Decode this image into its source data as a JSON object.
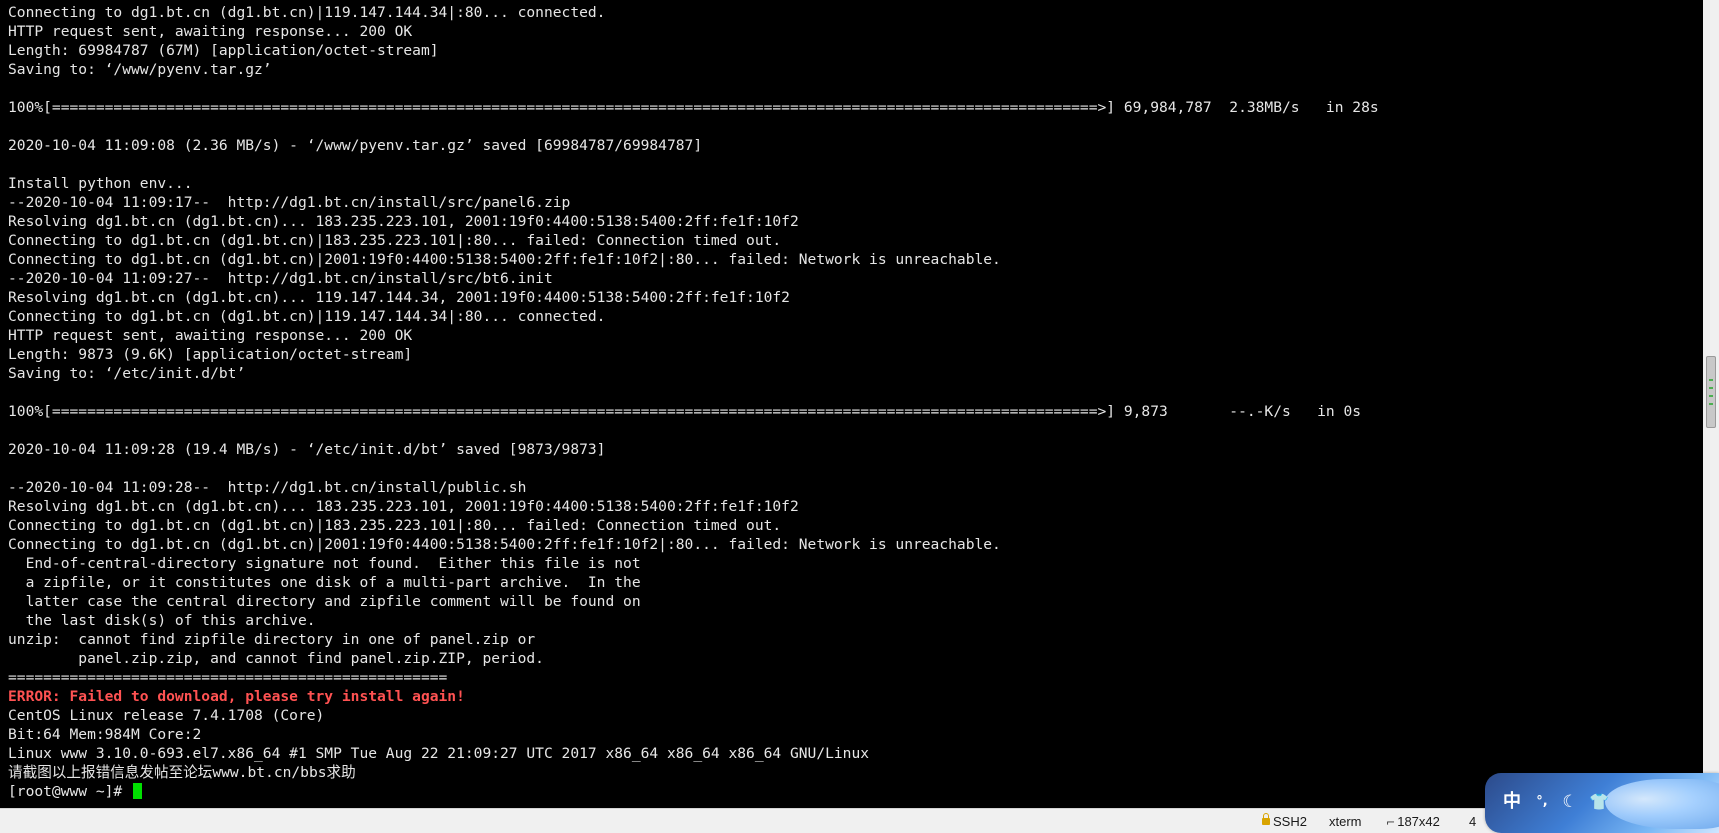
{
  "terminal": {
    "lines": [
      {
        "text": "Connecting to dg1.bt.cn (dg1.bt.cn)|119.147.144.34|:80... connected.",
        "kind": "normal"
      },
      {
        "text": "HTTP request sent, awaiting response... 200 OK",
        "kind": "normal"
      },
      {
        "text": "Length: 69984787 (67M) [application/octet-stream]",
        "kind": "normal"
      },
      {
        "text": "Saving to: ‘/www/pyenv.tar.gz’",
        "kind": "normal"
      },
      {
        "text": "",
        "kind": "normal"
      },
      {
        "text": "100%[=======================================================================================================================>] 69,984,787  2.38MB/s   in 28s",
        "kind": "normal"
      },
      {
        "text": "",
        "kind": "normal"
      },
      {
        "text": "2020-10-04 11:09:08 (2.36 MB/s) - ‘/www/pyenv.tar.gz’ saved [69984787/69984787]",
        "kind": "normal"
      },
      {
        "text": "",
        "kind": "normal"
      },
      {
        "text": "Install python env...",
        "kind": "normal"
      },
      {
        "text": "--2020-10-04 11:09:17--  http://dg1.bt.cn/install/src/panel6.zip",
        "kind": "normal"
      },
      {
        "text": "Resolving dg1.bt.cn (dg1.bt.cn)... 183.235.223.101, 2001:19f0:4400:5138:5400:2ff:fe1f:10f2",
        "kind": "normal"
      },
      {
        "text": "Connecting to dg1.bt.cn (dg1.bt.cn)|183.235.223.101|:80... failed: Connection timed out.",
        "kind": "normal"
      },
      {
        "text": "Connecting to dg1.bt.cn (dg1.bt.cn)|2001:19f0:4400:5138:5400:2ff:fe1f:10f2|:80... failed: Network is unreachable.",
        "kind": "normal"
      },
      {
        "text": "--2020-10-04 11:09:27--  http://dg1.bt.cn/install/src/bt6.init",
        "kind": "normal"
      },
      {
        "text": "Resolving dg1.bt.cn (dg1.bt.cn)... 119.147.144.34, 2001:19f0:4400:5138:5400:2ff:fe1f:10f2",
        "kind": "normal"
      },
      {
        "text": "Connecting to dg1.bt.cn (dg1.bt.cn)|119.147.144.34|:80... connected.",
        "kind": "normal"
      },
      {
        "text": "HTTP request sent, awaiting response... 200 OK",
        "kind": "normal"
      },
      {
        "text": "Length: 9873 (9.6K) [application/octet-stream]",
        "kind": "normal"
      },
      {
        "text": "Saving to: ‘/etc/init.d/bt’",
        "kind": "normal"
      },
      {
        "text": "",
        "kind": "normal"
      },
      {
        "text": "100%[=======================================================================================================================>] 9,873       --.-K/s   in 0s",
        "kind": "normal"
      },
      {
        "text": "",
        "kind": "normal"
      },
      {
        "text": "2020-10-04 11:09:28 (19.4 MB/s) - ‘/etc/init.d/bt’ saved [9873/9873]",
        "kind": "normal"
      },
      {
        "text": "",
        "kind": "normal"
      },
      {
        "text": "--2020-10-04 11:09:28--  http://dg1.bt.cn/install/public.sh",
        "kind": "normal"
      },
      {
        "text": "Resolving dg1.bt.cn (dg1.bt.cn)... 183.235.223.101, 2001:19f0:4400:5138:5400:2ff:fe1f:10f2",
        "kind": "normal"
      },
      {
        "text": "Connecting to dg1.bt.cn (dg1.bt.cn)|183.235.223.101|:80... failed: Connection timed out.",
        "kind": "normal"
      },
      {
        "text": "Connecting to dg1.bt.cn (dg1.bt.cn)|2001:19f0:4400:5138:5400:2ff:fe1f:10f2|:80... failed: Network is unreachable.",
        "kind": "normal"
      },
      {
        "text": "  End-of-central-directory signature not found.  Either this file is not",
        "kind": "normal"
      },
      {
        "text": "  a zipfile, or it constitutes one disk of a multi-part archive.  In the",
        "kind": "normal"
      },
      {
        "text": "  latter case the central directory and zipfile comment will be found on",
        "kind": "normal"
      },
      {
        "text": "  the last disk(s) of this archive.",
        "kind": "normal"
      },
      {
        "text": "unzip:  cannot find zipfile directory in one of panel.zip or",
        "kind": "normal"
      },
      {
        "text": "        panel.zip.zip, and cannot find panel.zip.ZIP, period.",
        "kind": "normal"
      },
      {
        "text": "==================================================",
        "kind": "normal"
      },
      {
        "text": "ERROR: Failed to download, please try install again!",
        "kind": "error"
      },
      {
        "text": "CentOS Linux release 7.4.1708 (Core)",
        "kind": "normal"
      },
      {
        "text": "Bit:64 Mem:984M Core:2",
        "kind": "normal"
      },
      {
        "text": "Linux www 3.10.0-693.el7.x86_64 #1 SMP Tue Aug 22 21:09:27 UTC 2017 x86_64 x86_64 x86_64 GNU/Linux",
        "kind": "normal"
      },
      {
        "text": "请截图以上报错信息发帖至论坛www.bt.cn/bbs求助",
        "kind": "normal"
      }
    ],
    "prompt": "[root@www ~]# ",
    "colors": {
      "background": "#000000",
      "foreground": "#e6e6e6",
      "error": "#ff5252",
      "cursor": "#00e000"
    }
  },
  "statusbar": {
    "connection": "SSH2",
    "terminal_type": "xterm",
    "size": "187x42",
    "extra": "4"
  },
  "ime": {
    "keys": [
      "中",
      "°,",
      "☾",
      "👕"
    ]
  }
}
